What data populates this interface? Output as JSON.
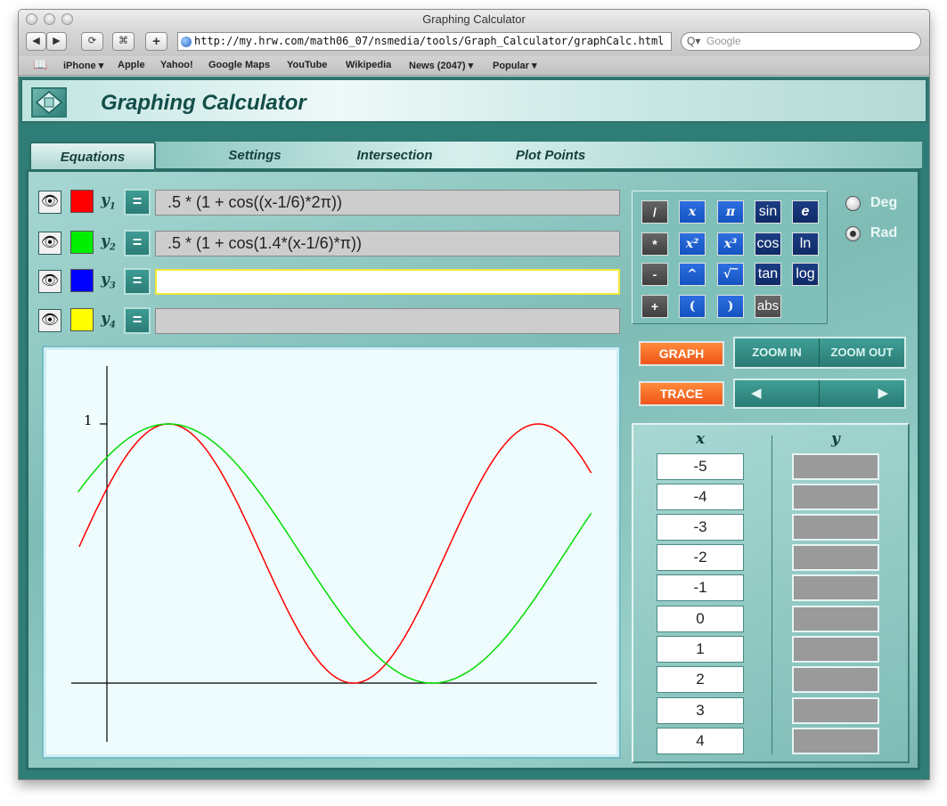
{
  "browser": {
    "window_title": "Graphing Calculator",
    "url": "http://my.hrw.com/math06_07/nsmedia/tools/Graph_Calculator/graphCalc.html",
    "search_placeholder": "Google",
    "back_icon": "back-arrow-icon",
    "forward_icon": "forward-arrow-icon",
    "bookmarks": [
      "iPhone",
      "Apple",
      "Yahoo!",
      "Google Maps",
      "YouTube",
      "Wikipedia",
      "News (2047)",
      "Popular"
    ]
  },
  "app": {
    "title": "Graphing Calculator",
    "tabs": [
      "Equations",
      "Settings",
      "Intersection",
      "Plot Points"
    ],
    "active_tab": "Equations"
  },
  "equations": [
    {
      "label": "y",
      "index": "1",
      "color": "#ff0000",
      "expression": ".5 * (1 + cos((x-1/6)*2π))",
      "eq_button": "="
    },
    {
      "label": "y",
      "index": "2",
      "color": "#00ee00",
      "expression": ".5 * (1 + cos(1.4*(x-1/6)*π))",
      "eq_button": "="
    },
    {
      "label": "y",
      "index": "3",
      "color": "#0000ff",
      "expression": "",
      "eq_button": "="
    },
    {
      "label": "y",
      "index": "4",
      "color": "#ffff00",
      "expression": "",
      "eq_button": "="
    }
  ],
  "keypad": [
    [
      "/",
      "x",
      "π",
      "sin",
      "e"
    ],
    [
      "*",
      "x²",
      "x³",
      "cos",
      "ln"
    ],
    [
      "-",
      "^",
      "√‾",
      "tan",
      "log"
    ],
    [
      "+",
      "(",
      ")",
      "abs"
    ]
  ],
  "angle_mode": {
    "options": [
      "Deg",
      "Rad"
    ],
    "selected": "Rad"
  },
  "buttons": {
    "graph": "GRAPH",
    "trace": "TRACE",
    "zoom_in": "ZOOM IN",
    "zoom_out": "ZOOM OUT",
    "trace_left": "◀",
    "trace_right": "▶"
  },
  "table": {
    "x_header": "x",
    "y_header": "y",
    "x_values": [
      "-5",
      "-4",
      "-3",
      "-2",
      "-1",
      "0",
      "1",
      "2",
      "3",
      "4"
    ]
  },
  "graph": {
    "y_tick_label": "1",
    "x_range": [
      -0.1,
      1.4
    ],
    "y_range": [
      -0.17,
      1.07
    ],
    "curve_colors": [
      "#ff0000",
      "#00dd00"
    ]
  }
}
